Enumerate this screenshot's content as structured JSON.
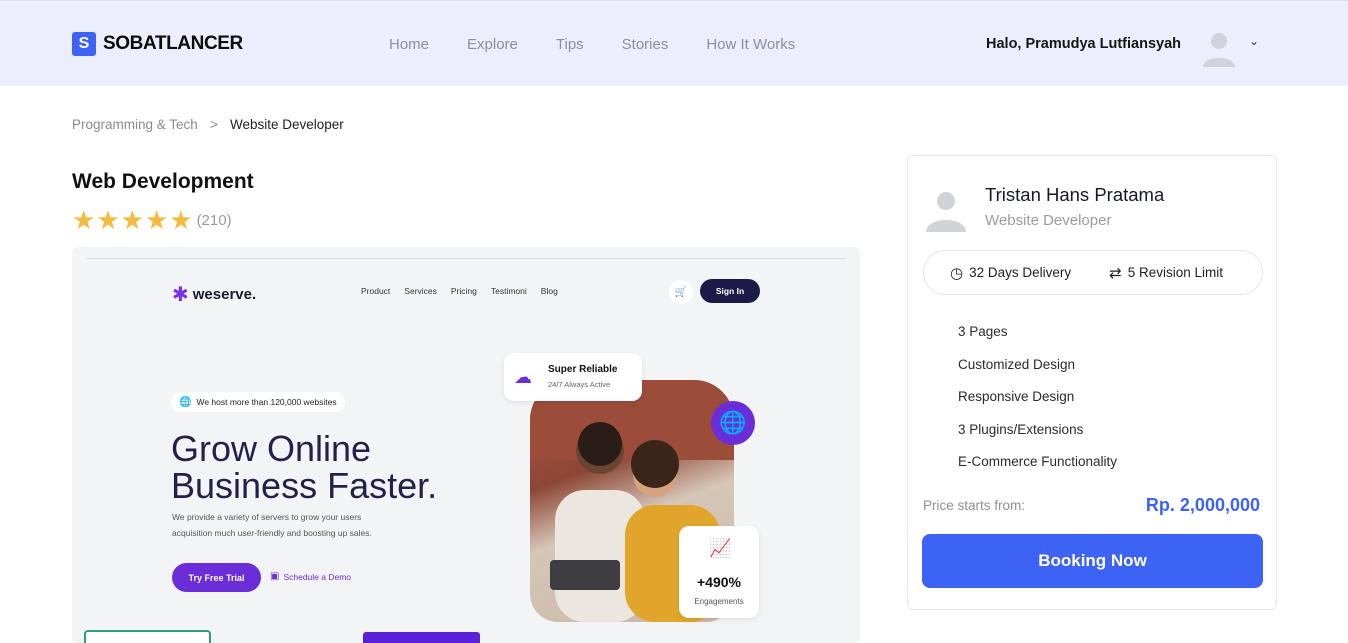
{
  "header": {
    "logo_mark": "S",
    "logo_text": "SOBATLANCER",
    "nav": [
      "Home",
      "Explore",
      "Tips",
      "Stories",
      "How It Works"
    ],
    "greeting": "Halo, Pramudya Lutfiansyah",
    "avatar_icon": "user-avatar-icon",
    "menu_icon": "chevron-down-icon"
  },
  "breadcrumb": {
    "parent": "Programming & Tech",
    "separator": ">",
    "current": "Website Developer"
  },
  "gig": {
    "title": "Web Development",
    "rating_stars": 5,
    "rating_count": "(210)"
  },
  "preview": {
    "brand": "weserve.",
    "nav": [
      "Product",
      "Services",
      "Pricing",
      "Testimoni",
      "Blog"
    ],
    "sign_in": "Sign In",
    "pill": "We host more than 120,000 websites",
    "hero_line1": "Grow Online",
    "hero_line2": "Business Faster.",
    "desc_line1": "We provide a variety of servers to grow your users",
    "desc_line2": "acquisition much user-friendly and boosting up sales.",
    "try_button": "Try Free Trial",
    "demo_link": "Schedule a Demo",
    "reliable_title": "Super Reliable",
    "reliable_sub": "24/7 Always Active",
    "engagement_value": "+490%",
    "engagement_label": "Engagements"
  },
  "card": {
    "seller_name": "Tristan Hans Pratama",
    "seller_role": "Website Developer",
    "delivery": "32 Days Delivery",
    "revisions": "5 Revision Limit",
    "features": [
      "3 Pages",
      "Customized Design",
      "Responsive Design",
      "3 Plugins/Extensions",
      "E-Commerce Functionality"
    ],
    "price_label": "Price starts from:",
    "price_value": "Rp. 2,000,000",
    "book_button": "Booking Now"
  },
  "colors": {
    "primary": "#3d63f5",
    "header_bg": "#eceefb",
    "star": "#f5bb3f",
    "preview_accent": "#6b2dd7"
  }
}
